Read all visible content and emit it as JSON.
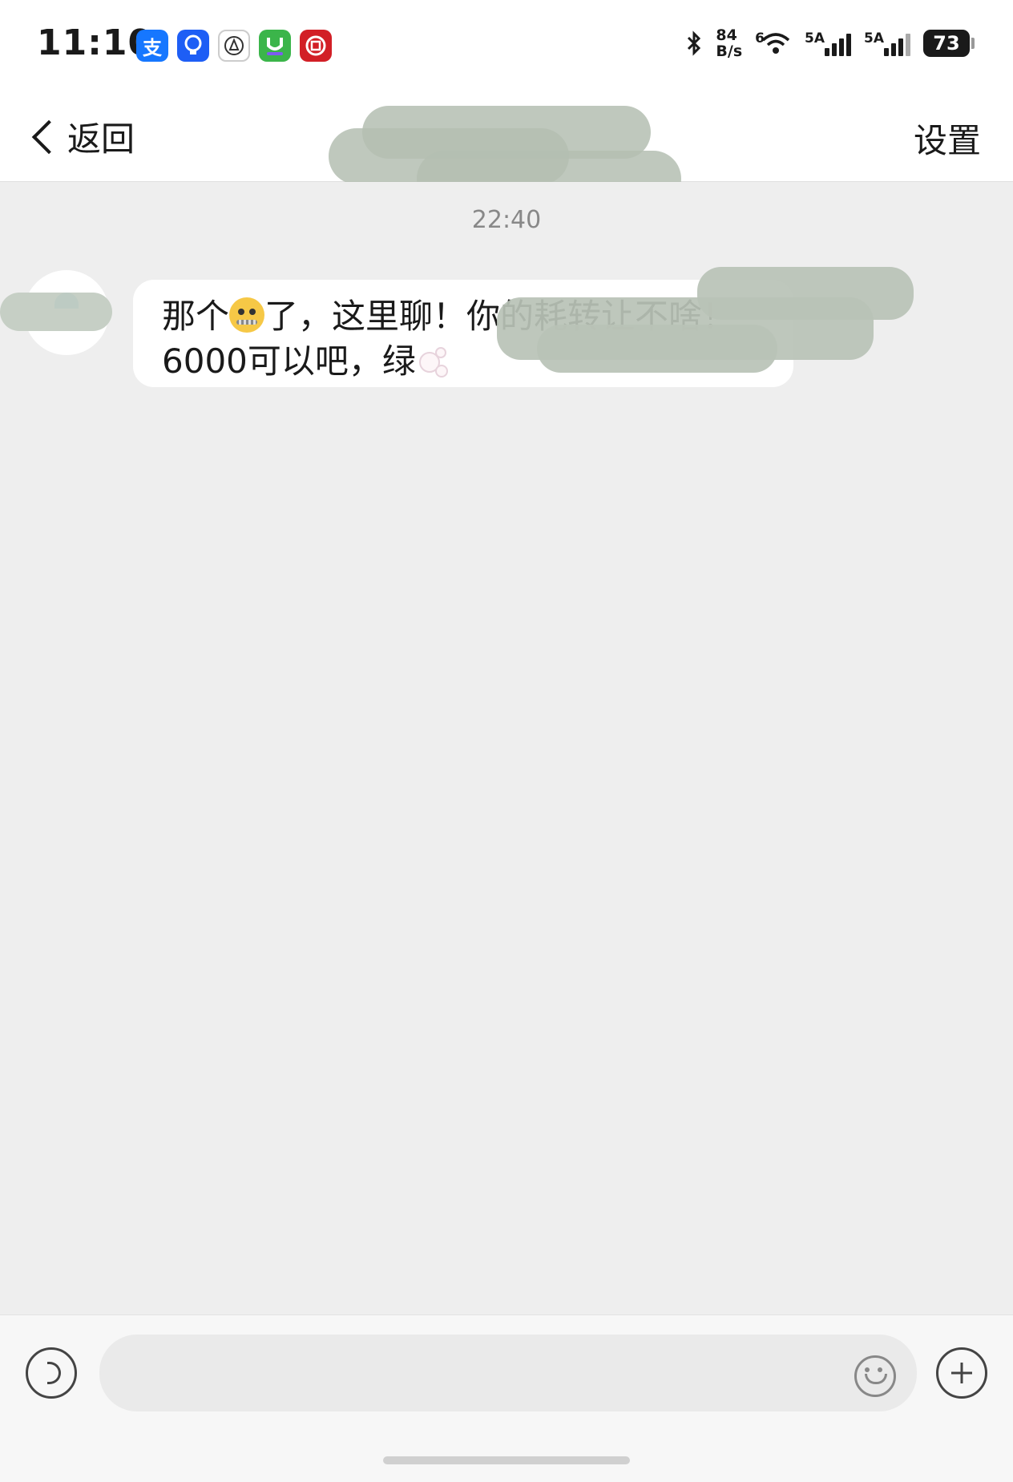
{
  "status_bar": {
    "time": "11:10",
    "apps": [
      {
        "name": "alipay-icon",
        "glyph": "支",
        "color": "#1677ff"
      },
      {
        "name": "bulb-app-icon",
        "glyph": "💡",
        "color": "#1e5ef5"
      },
      {
        "name": "railway-app-icon",
        "glyph": "A",
        "color": "#ffffff"
      },
      {
        "name": "ai-app-icon",
        "glyph": "U",
        "color": "#3bb54a"
      },
      {
        "name": "icbc-app-icon",
        "glyph": "E",
        "color": "#d21f26"
      }
    ],
    "net_speed_value": "84",
    "net_speed_unit": "B/s",
    "wifi_label": "6",
    "signal_1_label": "5A",
    "signal_2_label": "5A",
    "battery": "73"
  },
  "header": {
    "back_label": "返回",
    "settings_label": "设置"
  },
  "chat": {
    "timestamp": "22:40",
    "message": {
      "part1": "那个",
      "part2": "了，这里聊！你的耗转让不啥！\n6000可以吧，绿"
    }
  },
  "input_bar": {
    "placeholder": ""
  }
}
